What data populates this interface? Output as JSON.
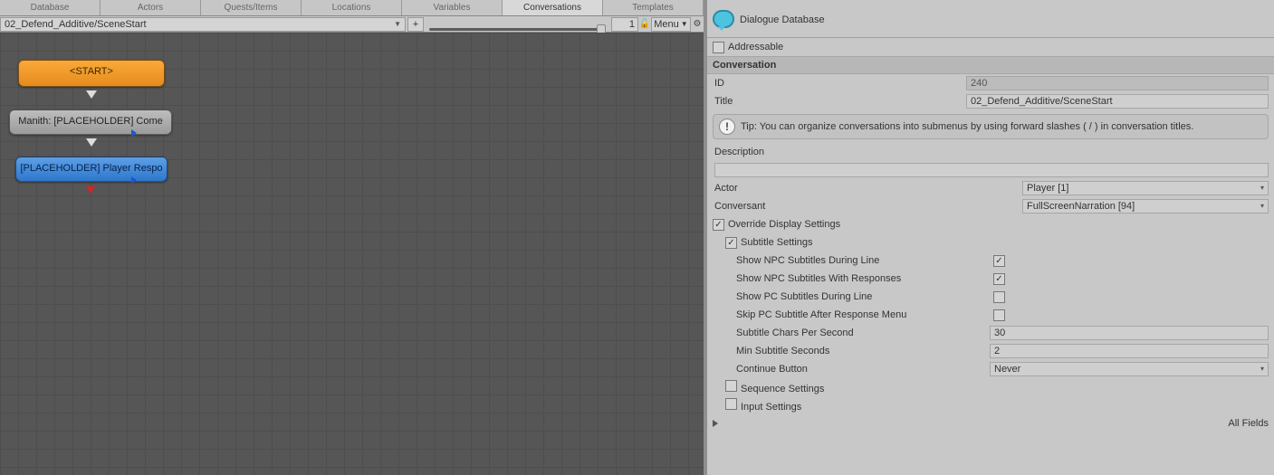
{
  "tabs": [
    "Database",
    "Actors",
    "Quests/Items",
    "Locations",
    "Variables",
    "Conversations",
    "Templates"
  ],
  "active_tab_index": 5,
  "toolbar": {
    "conversation_path": "02_Defend_Additive/SceneStart",
    "plus": "+",
    "zoom_value": "1",
    "menu_label": "Menu"
  },
  "nodes": {
    "start": "<START>",
    "grey": "Manith: [PLACEHOLDER] Come",
    "blue": "[PLACEHOLDER] Player Respo"
  },
  "inspector": {
    "title": "Dialogue Database",
    "addressable_label": "Addressable",
    "conversation_header": "Conversation",
    "id_label": "ID",
    "id_value": "240",
    "title_label": "Title",
    "title_value": "02_Defend_Additive/SceneStart",
    "tip": "Tip: You can organize conversations into submenus by using forward slashes ( / ) in conversation titles.",
    "description_label": "Description",
    "description_value": "",
    "actor_label": "Actor",
    "actor_value": "Player [1]",
    "conversant_label": "Conversant",
    "conversant_value": "FullScreenNarration [94]",
    "override_label": "Override Display Settings",
    "subtitle_settings_label": "Subtitle Settings",
    "npc_during_label": "Show NPC Subtitles During Line",
    "npc_with_resp_label": "Show NPC Subtitles With Responses",
    "pc_during_label": "Show PC Subtitles During Line",
    "skip_pc_label": "Skip PC Subtitle After Response Menu",
    "chars_sec_label": "Subtitle Chars Per Second",
    "chars_sec_value": "30",
    "min_sec_label": "Min Subtitle Seconds",
    "min_sec_value": "2",
    "continue_label": "Continue Button",
    "continue_value": "Never",
    "sequence_label": "Sequence Settings",
    "input_label": "Input Settings",
    "all_fields_label": "All Fields"
  }
}
